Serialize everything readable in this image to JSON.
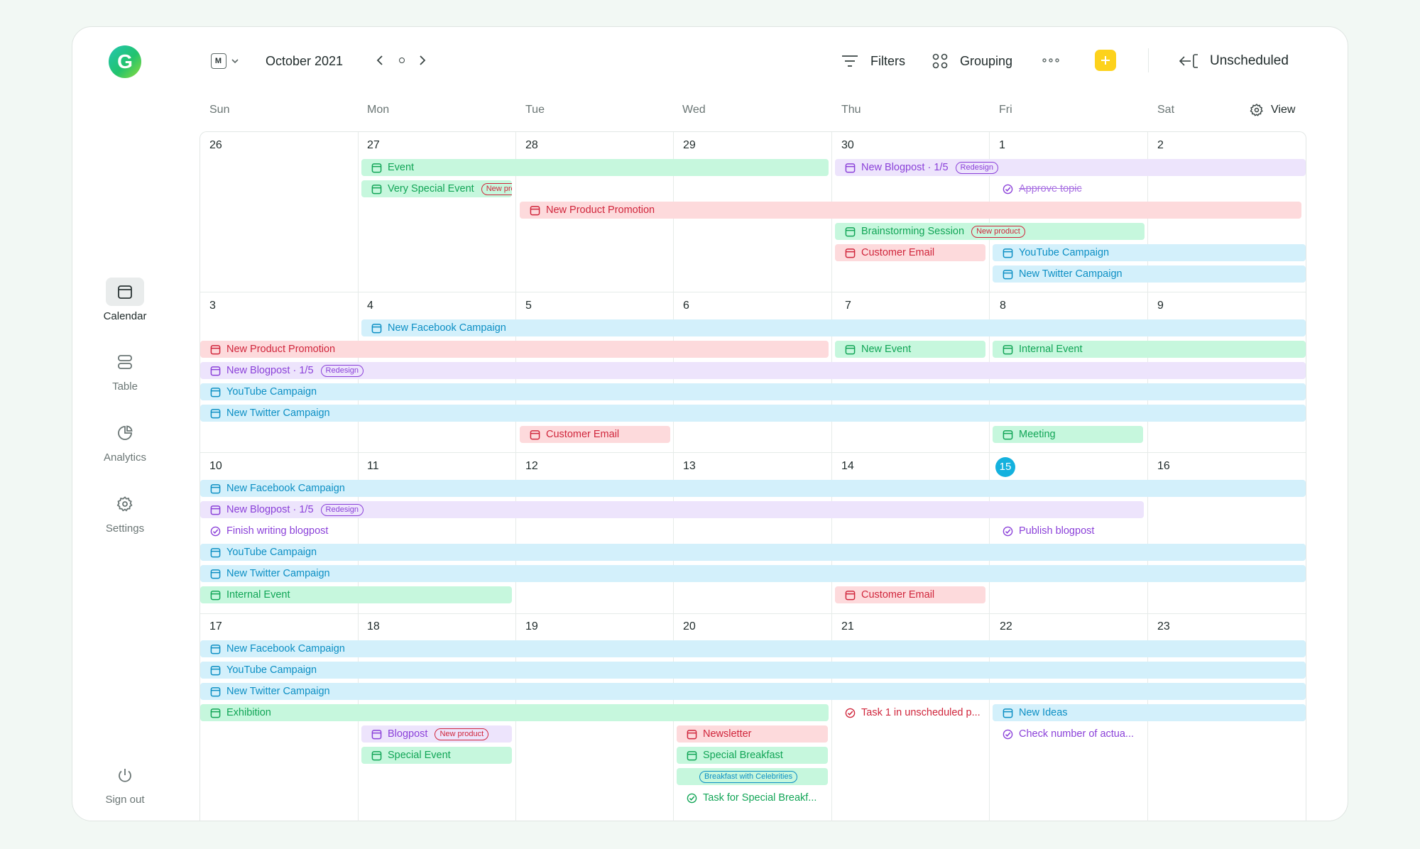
{
  "header": {
    "month": "October 2021",
    "view_badge": "M",
    "filters": "Filters",
    "grouping": "Grouping",
    "unscheduled": "Unscheduled",
    "view": "View"
  },
  "sidebar": {
    "items": [
      {
        "label": "Calendar"
      },
      {
        "label": "Table"
      },
      {
        "label": "Analytics"
      },
      {
        "label": "Settings"
      }
    ],
    "signout": "Sign out",
    "logo": "G"
  },
  "days": [
    "Sun",
    "Mon",
    "Tue",
    "Wed",
    "Thu",
    "Fri",
    "Sat"
  ],
  "weeks": [
    [
      "26",
      "27",
      "28",
      "29",
      "30",
      "1",
      "2"
    ],
    [
      "3",
      "4",
      "5",
      "6",
      "7",
      "8",
      "9"
    ],
    [
      "10",
      "11",
      "12",
      "13",
      "14",
      "15",
      "16"
    ],
    [
      "17",
      "18",
      "19",
      "20",
      "21",
      "22",
      "23"
    ]
  ],
  "today": "15",
  "colors": {
    "accent_today": "#14b1de",
    "add_button": "#fdd21c",
    "green": "#11a556",
    "red": "#d0263c",
    "purple": "#8b41d9",
    "blue": "#0c8fc4"
  },
  "events": [
    {
      "title": "Event"
    },
    {
      "title": "Very Special Event",
      "tag": "New product"
    },
    {
      "title": "New Blogpost · 1/5",
      "tag": "Redesign"
    },
    {
      "title": "Approve topic"
    },
    {
      "title": "New Product Promotion"
    },
    {
      "title": "Brainstorming Session",
      "tag": "New product"
    },
    {
      "title": "Customer Email"
    },
    {
      "title": "YouTube Campaign"
    },
    {
      "title": "New Twitter Campaign"
    },
    {
      "title": "New Facebook Campaign"
    },
    {
      "title": "New Product Promotion"
    },
    {
      "title": "New Event"
    },
    {
      "title": "Internal Event"
    },
    {
      "title": "New Blogpost · 1/5",
      "tag": "Redesign"
    },
    {
      "title": "YouTube Campaign"
    },
    {
      "title": "New Twitter Campaign"
    },
    {
      "title": "Customer Email"
    },
    {
      "title": "Meeting"
    },
    {
      "title": "New Facebook Campaign"
    },
    {
      "title": "New Blogpost · 1/5",
      "tag": "Redesign"
    },
    {
      "title": "Finish writing blogpost"
    },
    {
      "title": "Publish blogpost"
    },
    {
      "title": "YouTube Campaign"
    },
    {
      "title": "New Twitter Campaign"
    },
    {
      "title": "Internal Event"
    },
    {
      "title": "Customer Email"
    },
    {
      "title": "New Facebook Campaign"
    },
    {
      "title": "YouTube Campaign"
    },
    {
      "title": "New Twitter Campaign"
    },
    {
      "title": "Exhibition"
    },
    {
      "title": "Task 1 in unscheduled p..."
    },
    {
      "title": "New Ideas"
    },
    {
      "title": "Blogpost",
      "tag": "New product"
    },
    {
      "title": "Newsletter"
    },
    {
      "title": "Check number of actua..."
    },
    {
      "title": "Special Event"
    },
    {
      "title": "Special Breakfast"
    },
    {
      "title": "Breakfast with Celebrities"
    },
    {
      "title": "Task for Special Breakf..."
    }
  ]
}
